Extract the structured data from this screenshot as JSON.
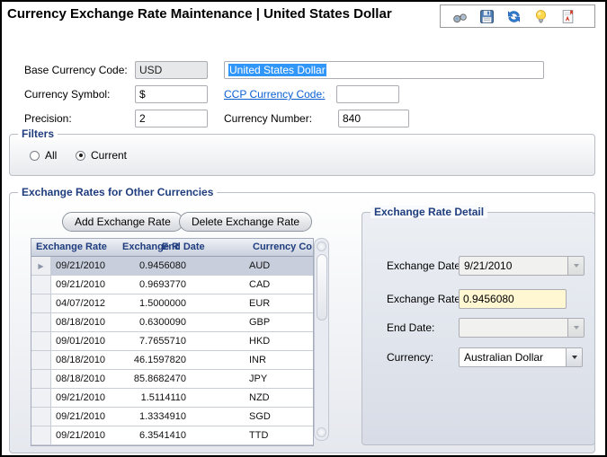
{
  "window": {
    "title": "Currency Exchange Rate Maintenance | United States Dollar"
  },
  "toolbar": {
    "icons": [
      {
        "name": "find-icon"
      },
      {
        "name": "save-icon"
      },
      {
        "name": "refresh-icon"
      },
      {
        "name": "lightbulb-icon"
      },
      {
        "name": "exit-icon"
      }
    ]
  },
  "form": {
    "base_currency_code": {
      "label": "Base Currency Code:",
      "value": "USD"
    },
    "currency_name": {
      "value": "United States Dollar"
    },
    "currency_symbol": {
      "label": "Currency Symbol:",
      "value": "$"
    },
    "ccp_currency_code": {
      "label": "CCP Currency Code:",
      "value": ""
    },
    "precision": {
      "label": "Precision:",
      "value": "2"
    },
    "currency_number": {
      "label": "Currency Number:",
      "value": "840"
    }
  },
  "filters": {
    "title": "Filters",
    "options": [
      {
        "label": "All",
        "selected": false
      },
      {
        "label": "Current",
        "selected": true
      }
    ]
  },
  "exchange_rates": {
    "title": "Exchange Rates for Other Currencies",
    "add_button": "Add Exchange Rate",
    "delete_button": "Delete Exchange Rate",
    "table": {
      "columns": [
        "Exchange Rate",
        "Exchange R",
        "End Date",
        "Currency Co"
      ],
      "rows": [
        {
          "exchange_date": "09/21/2010",
          "exchange_rate": "0.9456080",
          "end_date": "",
          "currency_code": "AUD",
          "selected": true
        },
        {
          "exchange_date": "09/21/2010",
          "exchange_rate": "0.9693770",
          "end_date": "",
          "currency_code": "CAD",
          "selected": false
        },
        {
          "exchange_date": "04/07/2012",
          "exchange_rate": "1.5000000",
          "end_date": "",
          "currency_code": "EUR",
          "selected": false
        },
        {
          "exchange_date": "08/18/2010",
          "exchange_rate": "0.6300090",
          "end_date": "",
          "currency_code": "GBP",
          "selected": false
        },
        {
          "exchange_date": "09/01/2010",
          "exchange_rate": "7.7655710",
          "end_date": "",
          "currency_code": "HKD",
          "selected": false
        },
        {
          "exchange_date": "08/18/2010",
          "exchange_rate": "46.1597820",
          "end_date": "",
          "currency_code": "INR",
          "selected": false
        },
        {
          "exchange_date": "08/18/2010",
          "exchange_rate": "85.8682470",
          "end_date": "",
          "currency_code": "JPY",
          "selected": false
        },
        {
          "exchange_date": "09/21/2010",
          "exchange_rate": "1.5114110",
          "end_date": "",
          "currency_code": "NZD",
          "selected": false
        },
        {
          "exchange_date": "09/21/2010",
          "exchange_rate": "1.3334910",
          "end_date": "",
          "currency_code": "SGD",
          "selected": false
        },
        {
          "exchange_date": "09/21/2010",
          "exchange_rate": "6.3541410",
          "end_date": "",
          "currency_code": "TTD",
          "selected": false
        }
      ]
    }
  },
  "detail": {
    "title": "Exchange Rate Detail",
    "exchange_date": {
      "label": "Exchange Date:",
      "value": "9/21/2010"
    },
    "exchange_rate": {
      "label": "Exchange Rate:",
      "value": "0.9456080"
    },
    "end_date": {
      "label": "End Date:",
      "value": ""
    },
    "currency": {
      "label": "Currency:",
      "value": "Australian Dollar"
    }
  },
  "colors": {
    "groupbox_label": "#1f3d7e",
    "selected_row": "#c8cedb",
    "highlight_field": "#fff6d2",
    "selection_blue": "#3196fa",
    "link_blue": "#0b5fd0"
  }
}
